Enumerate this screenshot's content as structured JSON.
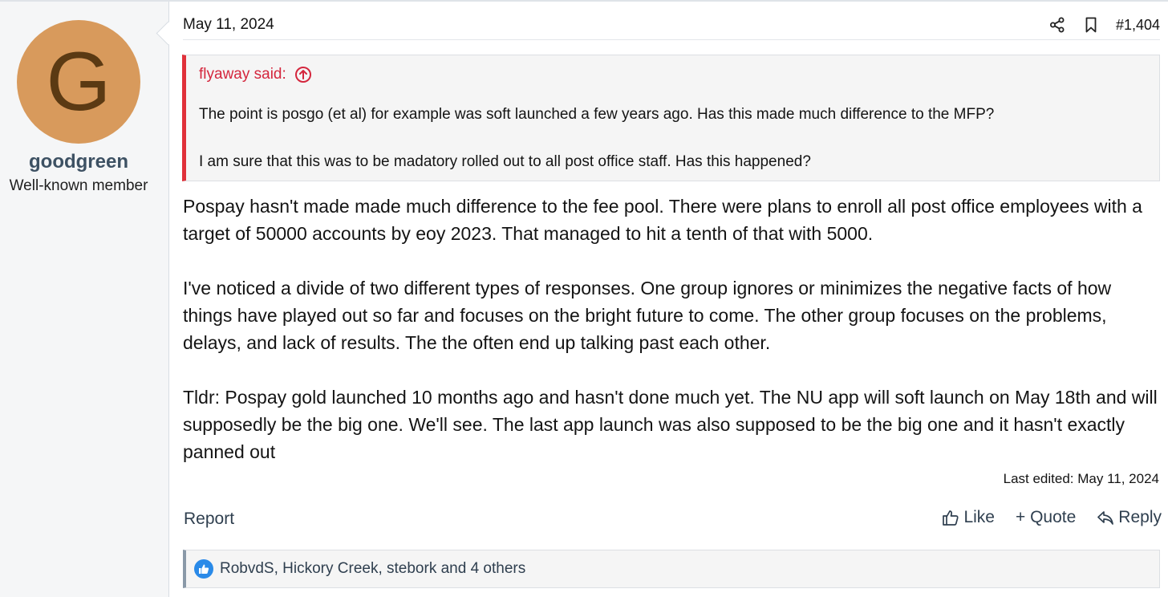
{
  "post": {
    "date": "May 11, 2024",
    "number": "#1,404",
    "last_edited": "Last edited: May 11, 2024"
  },
  "author": {
    "avatar_letter": "G",
    "avatar_color": "#d89a5c",
    "username": "goodgreen",
    "title": "Well-known member"
  },
  "quote": {
    "attribution": "flyaway said:",
    "accent_color": "#e0313a",
    "lines": [
      "The point is posgo (et al) for example was soft launched a few years ago. Has this made much difference to the MFP?",
      "I am sure that this was to be madatory rolled out to all post office staff. Has this happened?"
    ]
  },
  "body": {
    "paragraphs": [
      "Pospay hasn't made made much difference to the fee pool. There were plans to enroll all post office employees with a target of 50000 accounts by eoy 2023. That managed to hit a tenth of that with 5000.",
      "I've noticed a divide of two different types of responses. One group ignores or minimizes the negative facts of how things have played out so far and focuses on the bright future to come. The other group focuses on the problems, delays, and lack of results. The the often end up talking past each other.",
      "Tldr: Pospay gold launched 10 months ago and hasn't done much yet. The NU app will soft launch on May 18th and will supposedly be the big one. We'll see. The last app launch was also supposed to be the big one and it hasn't exactly panned out"
    ]
  },
  "actions": {
    "report": "Report",
    "like": "Like",
    "quote": "+ Quote",
    "reply": "Reply"
  },
  "reactions": {
    "text": "RobvdS, Hickory Creek, stebork and 4 others",
    "icon": "thumbs-up-icon",
    "badge_color": "#2a8ae8"
  },
  "icons": {
    "share": "share-icon",
    "bookmark": "bookmark-icon",
    "quote_jump": "arrow-up-circle-icon",
    "like": "thumbs-up-icon",
    "reply": "reply-icon"
  }
}
